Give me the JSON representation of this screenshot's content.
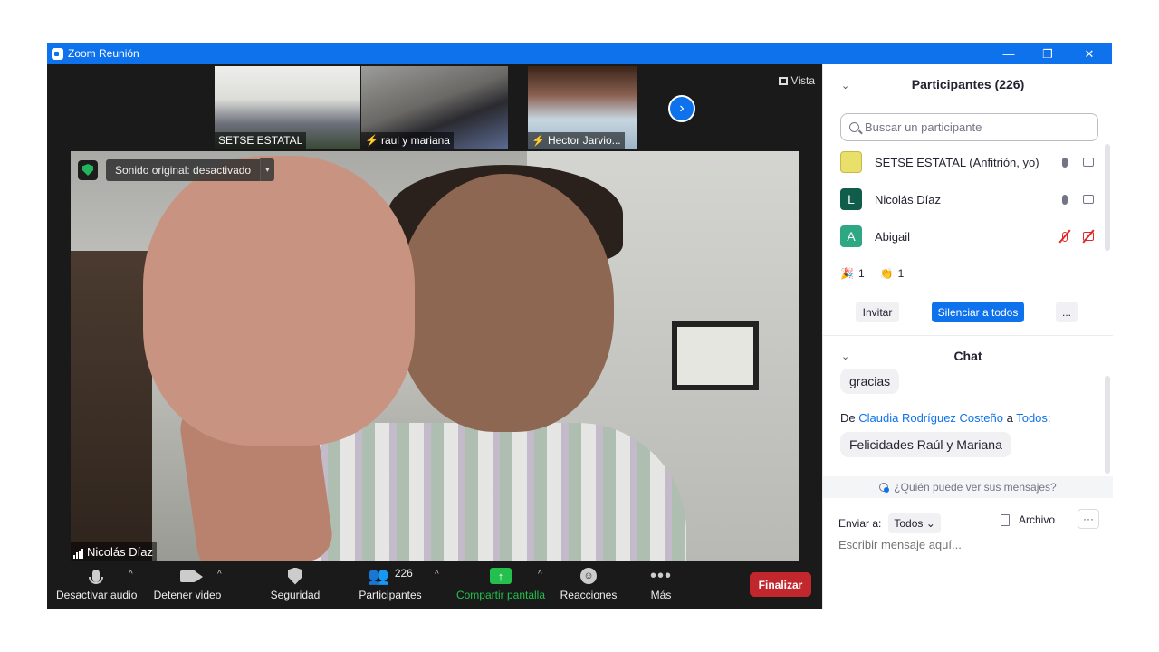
{
  "window": {
    "title": "Zoom Reunión",
    "minimize": "—",
    "restore": "❐",
    "close": "✕"
  },
  "thumbnails": [
    {
      "label": "SETSE ESTATAL",
      "muted": false
    },
    {
      "label": "raul y mariana",
      "muted": true
    },
    {
      "label": "Hector Jarvio...",
      "muted": true
    }
  ],
  "next_icon": "›",
  "vista": {
    "label": "Vista"
  },
  "video": {
    "sound_label": "Sonido original: desactivado",
    "sound_caret": "▾",
    "speaker_name": "Nicolás Díaz"
  },
  "toolbar": {
    "caret": "^",
    "mute_label": "Desactivar audio",
    "video_label": "Detener video",
    "security_label": "Seguridad",
    "participants_label": "Participantes",
    "participants_count": "226",
    "share_label": "Compartir pantalla",
    "share_icon": "↑",
    "reactions_label": "Reacciones",
    "reactions_icon": "☺",
    "more_label": "Más",
    "more_icon": "•••",
    "end_label": "Finalizar"
  },
  "participants_panel": {
    "chevron": "⌄",
    "title": "Participantes (226)",
    "search_placeholder": "Buscar un participante",
    "participants": [
      {
        "name": "SETSE ESTATAL (Anfitrión, yo)",
        "avatar": "",
        "color": "#e8e06a",
        "audio": "on",
        "video": "on"
      },
      {
        "name": "Nicolás Díaz",
        "avatar": "L",
        "color": "#0f5d4a",
        "audio": "on",
        "video": "on"
      },
      {
        "name": "Abigail",
        "avatar": "A",
        "color": "#2ea882",
        "audio": "muted",
        "video": "off"
      }
    ],
    "reactions": [
      {
        "icon": "🎉",
        "count": "1"
      },
      {
        "icon": "👏",
        "count": "1"
      }
    ],
    "invite_label": "Invitar",
    "mute_all_label": "Silenciar a todos",
    "more_label": "..."
  },
  "chat_panel": {
    "chevron": "⌄",
    "title": "Chat",
    "prev_message": "gracias",
    "from_prefix": "De",
    "from_name": "Claudia Rodríguez Costeño",
    "to_word": "a",
    "to_name": "Todos:",
    "message": "Felicidades Raúl y Mariana",
    "who_sees": "¿Quién puede ver sus mensajes?",
    "send_to_label": "Enviar a:",
    "send_to_value": "Todos",
    "send_to_caret": "⌄",
    "file_label": "Archivo",
    "more_label": "···",
    "input_placeholder": "Escribir mensaje aquí..."
  },
  "colors": {
    "accent": "#0e72ed",
    "end_button": "#c1272d",
    "share": "#23c04e",
    "muted": "#e02828"
  }
}
